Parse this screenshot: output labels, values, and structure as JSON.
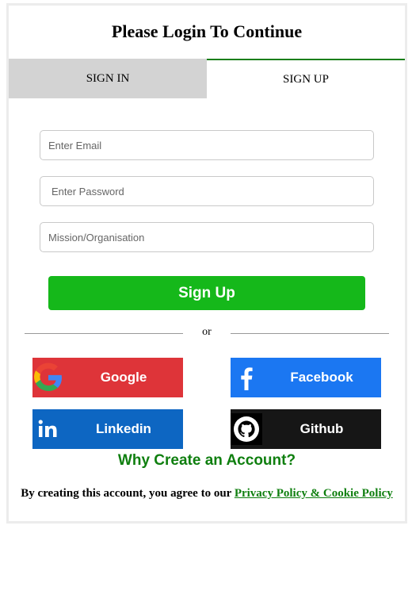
{
  "page": {
    "title": "Please Login To Continue"
  },
  "tabs": {
    "signin": "SIGN IN",
    "signup": "SIGN UP"
  },
  "form": {
    "email_placeholder": "Enter Email",
    "password_placeholder": "Enter Password",
    "mission_placeholder": "Mission/Organisation",
    "submit_label": "Sign Up"
  },
  "divider": {
    "text": "or"
  },
  "social": {
    "google": "Google",
    "facebook": "Facebook",
    "linkedin": "Linkedin",
    "github": "Github"
  },
  "why": "Why Create an Account?",
  "terms": {
    "prefix": "By creating this account, you agree to our",
    "link": "Privacy Policy & Cookie Policy"
  },
  "colors": {
    "primary_green": "#15b81a",
    "link_green": "#0f7f0f",
    "google": "#de3439",
    "facebook": "#1b77f2",
    "linkedin": "#0d66c2",
    "github": "#161616"
  }
}
